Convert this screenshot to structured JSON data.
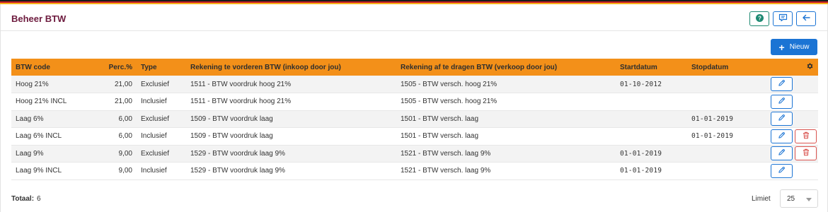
{
  "colors": {
    "stripe_top": "#1a1a1a",
    "stripe_mid": "#c81d25",
    "stripe_bottom": "#f6b11a",
    "title": "#6d1b3e",
    "header_row": "#f39019",
    "primary": "#1b74d4",
    "help": "#1f8a73",
    "danger": "#d9534f"
  },
  "header": {
    "title": "Beheer BTW",
    "buttons": [
      {
        "icon": "help-icon"
      },
      {
        "icon": "comment-icon"
      },
      {
        "icon": "arrow-left-icon"
      }
    ]
  },
  "toolbar": {
    "new_label": "Nieuw"
  },
  "table": {
    "columns": [
      "BTW code",
      "Perc.%",
      "Type",
      "Rekening te vorderen BTW (inkoop door jou)",
      "Rekening af te dragen BTW (verkoop door jou)",
      "Startdatum",
      "Stopdatum"
    ],
    "rows": [
      {
        "code": "Hoog 21%",
        "perc": "21,00",
        "type": "Exclusief",
        "inkoop": "1511 - BTW voordruk hoog 21%",
        "verkoop": "1505 - BTW versch. hoog 21%",
        "start": "01-10-2012",
        "stop": "",
        "delete": false
      },
      {
        "code": "Hoog 21% INCL",
        "perc": "21,00",
        "type": "Inclusief",
        "inkoop": "1511 - BTW voordruk hoog 21%",
        "verkoop": "1505 - BTW versch. hoog 21%",
        "start": "",
        "stop": "",
        "delete": false
      },
      {
        "code": "Laag 6%",
        "perc": "6,00",
        "type": "Exclusief",
        "inkoop": "1509 - BTW voordruk laag",
        "verkoop": "1501 - BTW versch. laag",
        "start": "",
        "stop": "01-01-2019",
        "delete": false
      },
      {
        "code": "Laag 6% INCL",
        "perc": "6,00",
        "type": "Inclusief",
        "inkoop": "1509 - BTW voordruk laag",
        "verkoop": "1501 - BTW versch. laag",
        "start": "",
        "stop": "01-01-2019",
        "delete": true
      },
      {
        "code": "Laag 9%",
        "perc": "9,00",
        "type": "Exclusief",
        "inkoop": "1529 - BTW voordruk laag 9%",
        "verkoop": "1521 - BTW versch. laag 9%",
        "start": "01-01-2019",
        "stop": "",
        "delete": true
      },
      {
        "code": "Laag 9% INCL",
        "perc": "9,00",
        "type": "Inclusief",
        "inkoop": "1529 - BTW voordruk laag 9%",
        "verkoop": "1521 - BTW versch. laag 9%",
        "start": "01-01-2019",
        "stop": "",
        "delete": false
      }
    ]
  },
  "footer": {
    "total_label": "Totaal:",
    "total_value": "6",
    "limit_label": "Limiet",
    "limit_value": "25"
  }
}
